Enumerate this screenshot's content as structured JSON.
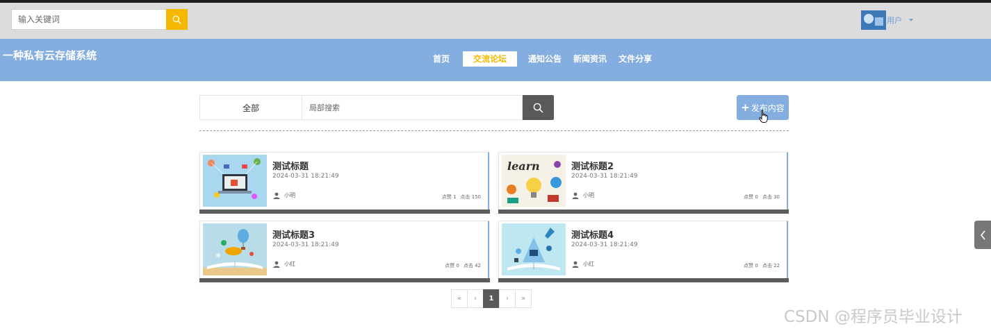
{
  "header": {
    "search_placeholder": "输入关键词",
    "user_name": "用户"
  },
  "navbar": {
    "brand": "一种私有云存储系统",
    "items": [
      {
        "label": "首页",
        "active": false
      },
      {
        "label": "交流论坛",
        "active": true
      },
      {
        "label": "通知公告",
        "active": false
      },
      {
        "label": "新闻资讯",
        "active": false
      },
      {
        "label": "文件分享",
        "active": false
      }
    ]
  },
  "filter": {
    "category_label": "全部",
    "search_placeholder": "局部搜索",
    "publish_label": "发布内容"
  },
  "posts": [
    {
      "title": "测试标题",
      "time": "2024-03-31 18:21:49",
      "author": "小明",
      "likes": "点赞 1",
      "clicks": "点击 150",
      "thumb": "laptop-marketing-illustration"
    },
    {
      "title": "测试标题2",
      "time": "2024-03-31 18:21:49",
      "author": "小明",
      "likes": "点赞 0",
      "clicks": "点击 30",
      "thumb": "learn-lightbulb-illustration"
    },
    {
      "title": "测试标题3",
      "time": "2024-03-31 18:21:49",
      "author": "小红",
      "likes": "点赞 0",
      "clicks": "点击 42",
      "thumb": "open-book-balloon-illustration"
    },
    {
      "title": "测试标题4",
      "time": "2024-03-31 18:21:49",
      "author": "小红",
      "likes": "点赞 0",
      "clicks": "点击 22",
      "thumb": "open-book-rocket-illustration"
    }
  ],
  "pagination": {
    "first": "«",
    "prev": "‹",
    "current": "1",
    "next": "›",
    "last": "»"
  },
  "side_tab_icon": "chevron-left-icon",
  "watermark": "CSDN @程序员毕业设计",
  "colors": {
    "accent": "#84ade0",
    "highlight": "#f5b800",
    "dark": "#595959"
  }
}
